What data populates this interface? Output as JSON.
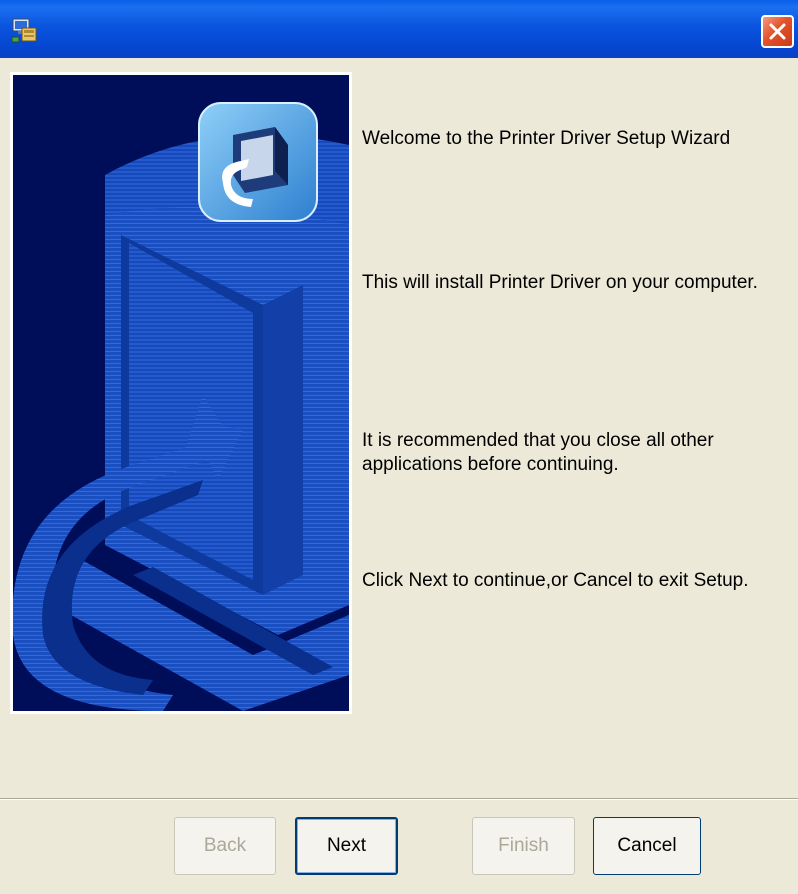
{
  "window": {
    "title": "",
    "title_icon": "setup-installer-icon",
    "close_icon": "close-x-icon"
  },
  "banner": {
    "image": "printer-setup-banner",
    "icon": "printer-icon"
  },
  "content": {
    "welcome": "Welcome to the Printer Driver Setup Wizard",
    "install_info": "This will install Printer Driver on your computer.",
    "recommendation": "It is recommended that you close all other applications before continuing.",
    "instructions": "Click Next to continue,or Cancel to exit Setup."
  },
  "buttons": {
    "back": "Back",
    "next": "Next",
    "finish": "Finish",
    "cancel": "Cancel"
  },
  "colors": {
    "titlebar": "#0548D2",
    "dialog_bg": "#ECE9D8",
    "banner_bg": "#000E5A",
    "banner_art": "#1E5FD6",
    "close_button": "#E5522A",
    "disabled_text": "#ACA899"
  }
}
